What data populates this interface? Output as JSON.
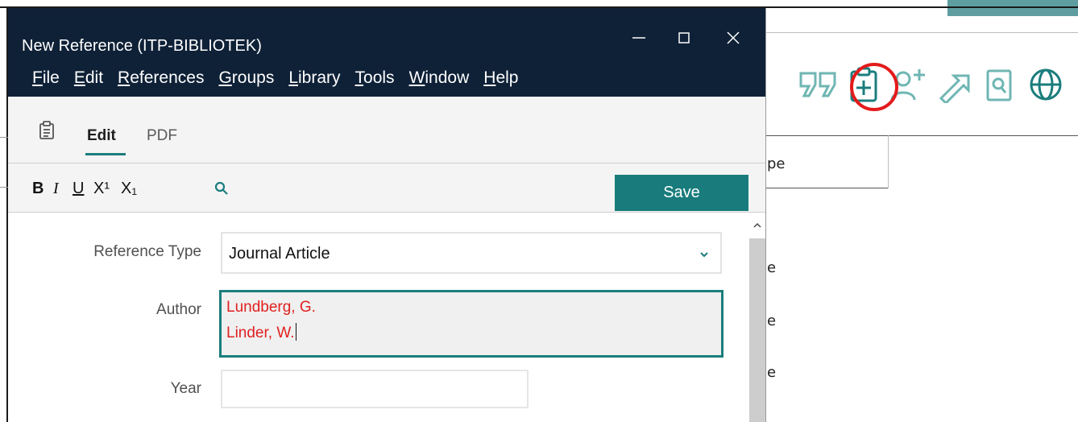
{
  "window": {
    "title": "New Reference (ITP-BIBLIOTEK)",
    "minimize_glyph": "—",
    "maximize_glyph": "☐",
    "close_glyph": "✕"
  },
  "menu": [
    {
      "label": "File",
      "accel": "F",
      "rest": "ile"
    },
    {
      "label": "Edit",
      "accel": "E",
      "rest": "dit"
    },
    {
      "label": "References",
      "accel": "R",
      "rest": "eferences"
    },
    {
      "label": "Groups",
      "accel": "G",
      "rest": "roups"
    },
    {
      "label": "Library",
      "accel": "L",
      "rest": "ibrary"
    },
    {
      "label": "Tools",
      "accel": "T",
      "rest": "ools"
    },
    {
      "label": "Window",
      "accel": "W",
      "rest": "indow"
    },
    {
      "label": "Help",
      "accel": "H",
      "rest": "elp"
    }
  ],
  "tabs": {
    "edit": "Edit",
    "pdf": "PDF",
    "icon": "clipboard-icon"
  },
  "format_toolbar": {
    "bold": "B",
    "italic": "I",
    "underline": "U",
    "superscript": "X¹",
    "subscript": "X₁",
    "search_icon": "search-icon",
    "save_label": "Save"
  },
  "form": {
    "reference_type_label": "Reference Type",
    "reference_type_value": "Journal Article",
    "author_label": "Author",
    "authors": [
      "Lundberg, G.",
      "Linder, W."
    ],
    "year_label": "Year",
    "year_value": ""
  },
  "background": {
    "fragments": [
      "pe",
      "e",
      "e",
      "e"
    ],
    "toolbar_icons": [
      "quote-icon",
      "new-reference-icon",
      "add-user-icon",
      "share-arrow-icon",
      "find-pdf-icon",
      "globe-icon"
    ],
    "highlight_color": "#e31b1b",
    "accent_color": "#1b7d7d"
  }
}
